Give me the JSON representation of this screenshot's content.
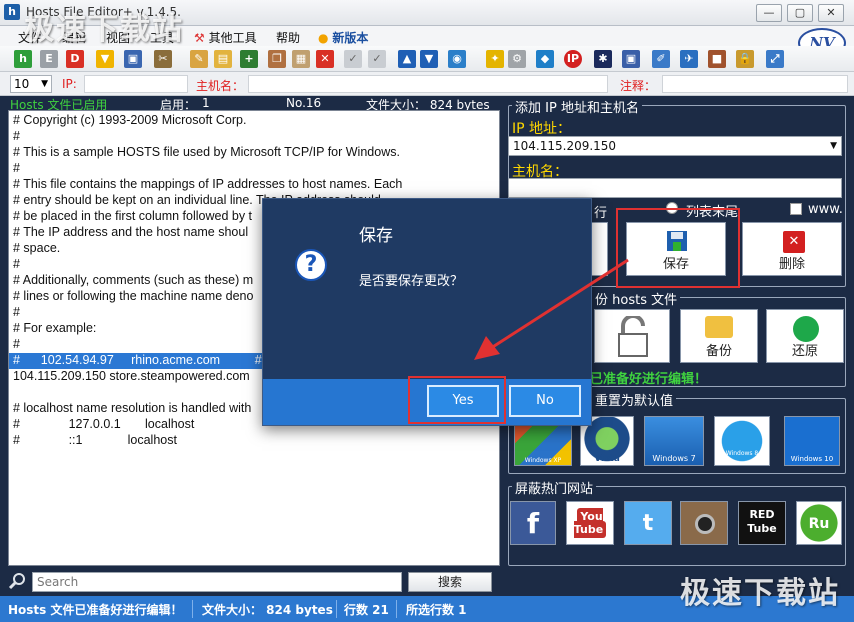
{
  "window": {
    "title": "Hosts File Editor+ v.1.4.5.",
    "app_icon_letter": "h",
    "min_btn": "—",
    "max_btn": "▢",
    "close_btn": "✕"
  },
  "watermark": "极速下载站",
  "menu": {
    "items": [
      "文件",
      "编辑",
      "视图",
      "工具",
      "其他工具",
      "帮助",
      "新版本"
    ]
  },
  "toolbar": {
    "icons": [
      "h-icon",
      "e-icon",
      "d-icon",
      "open-folder-icon",
      "save-icon",
      "tools-icon",
      "edit-icon",
      "folder-icon",
      "add-icon",
      "copy-icon",
      "paste-icon",
      "delete-icon",
      "check-icon",
      "check-icon",
      "up-arrow-icon",
      "down-arrow-icon",
      "globe-icon",
      "settings-icon",
      "gear-icon",
      "network-icon",
      "ip-icon",
      "windows-icon",
      "document-icon",
      "brush-icon",
      "plane-icon",
      "package-icon",
      "lock-icon",
      "expand-icon"
    ]
  },
  "fieldbar": {
    "row_count": "10",
    "ip_label": "IP:",
    "host_label": "主机名：",
    "comment_label": "注释："
  },
  "status_top": {
    "state": "Hosts 文件已启用",
    "enabled_label": "启用：",
    "enabled_value": "1",
    "row_no": "No.16",
    "file_size": "文件大小：  824 bytes"
  },
  "editor": {
    "lines": [
      "# Copyright (c) 1993-2009 Microsoft Corp.",
      "#",
      "# This is a sample HOSTS file used by Microsoft TCP/IP for Windows.",
      "#",
      "# This file contains the mappings of IP addresses to host names. Each",
      "# entry should be kept on an individual line. The IP address should",
      "# be placed in the first column followed by t",
      "# The IP address and the host name shoul",
      "# space.",
      "#",
      "# Additionally, comments (such as these) m",
      "# lines or following the machine name deno",
      "#",
      "# For example:",
      "#",
      "#      102.54.94.97     rhino.acme.com          # s",
      "104.115.209.150 store.steampowered.com",
      "",
      "# localhost name resolution is handled with",
      "#              127.0.0.1       localhost",
      "#              ::1             localhost"
    ],
    "highlight_index": 15
  },
  "search": {
    "placeholder": "Search",
    "button": "搜索"
  },
  "right": {
    "add_group_title": "添加 IP 地址和主机名",
    "ip_label": "IP 地址：",
    "ip_value": "104.115.209.150",
    "host_label": "主机名：",
    "host_value": "",
    "pos_first": "行",
    "pos_end": "列表末尾",
    "www_label": "www.",
    "save_btn": "保存",
    "delete_btn": "删除",
    "backup_group_title": "份 hosts 文件",
    "backup_btn": "备份",
    "restore_btn": "还原",
    "ready_msg": "已准备好进行编辑！",
    "reset_group_title": "重置为默认值",
    "os_tiles": [
      "Windows XP",
      "Vista",
      "Windows 7",
      "Windows 8",
      "Windows 10"
    ],
    "block_group_title": "屏蔽热门网站",
    "site_tiles": [
      "f",
      "You Tube",
      "t",
      "instagram",
      "RED Tube",
      "Ru"
    ]
  },
  "dialog": {
    "title": "保存",
    "icon": "?",
    "message": "是否要保存更改？",
    "yes": "Yes",
    "no": "No"
  },
  "statusbar": {
    "state": "Hosts 文件已准备好进行编辑！",
    "size": "文件大小：  824 bytes",
    "rows": "行数 21",
    "selected": "所选行数 1"
  },
  "colors": {
    "accent": "#2c78d0",
    "panel": "#1c2b45",
    "highlight": "#e03131",
    "yellow": "#ffd800"
  }
}
